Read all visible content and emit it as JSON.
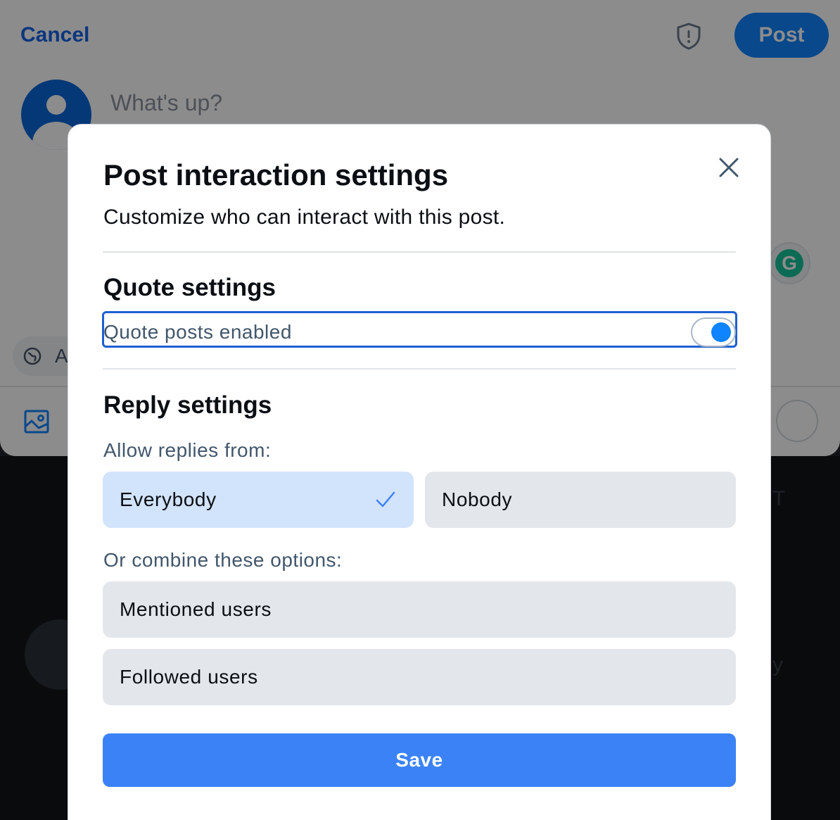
{
  "composer": {
    "cancel_label": "Cancel",
    "post_label": "Post",
    "placeholder": "What's up?",
    "language_label": "A",
    "grammarly_letter": "G"
  },
  "feed": {
    "partial_text_1": "T",
    "partial_text_2": "y"
  },
  "modal": {
    "title": "Post interaction settings",
    "subtitle": "Customize who can interact with this post.",
    "quote_heading": "Quote settings",
    "quote_toggle_label": "Quote posts enabled",
    "quote_enabled": true,
    "reply_heading": "Reply settings",
    "allow_label": "Allow replies from:",
    "options": [
      {
        "label": "Everybody",
        "selected": true
      },
      {
        "label": "Nobody",
        "selected": false
      }
    ],
    "combine_label": "Or combine these options:",
    "combine_options": [
      {
        "label": "Mentioned users",
        "selected": false
      },
      {
        "label": "Followed users",
        "selected": false
      }
    ],
    "save_label": "Save"
  },
  "colors": {
    "accent": "#1083fe",
    "save_button": "#3b82f6",
    "selected_option": "#d2e3fc",
    "option_bg": "#e3e6ea",
    "focus_ring": "#1d5fd2"
  },
  "icons": [
    "shield-icon",
    "avatar-icon",
    "globe-icon",
    "image-icon",
    "close-icon",
    "check-icon"
  ]
}
